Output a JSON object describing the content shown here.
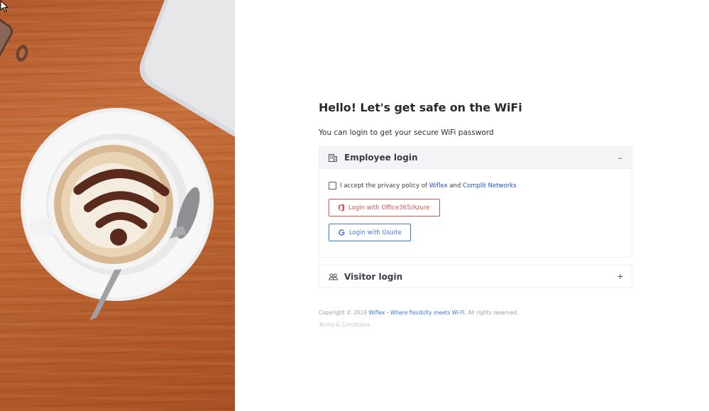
{
  "heading": "Hello! Let's get safe on the WiFi",
  "subheading": "You can login to get your secure WiFi password",
  "employee": {
    "title": "Employee login",
    "toggle": "–",
    "consent": {
      "prefix": "I accept the privacy policy of",
      "link1": "Wiflex",
      "and": "and",
      "link2": "Complit Networks"
    },
    "office_button": "Login with Office365/Azure",
    "gsuite_button": "Login with Gsuite"
  },
  "visitor": {
    "title": "Visitor login",
    "toggle": "+"
  },
  "footer": {
    "copyright": "Copyright © 2019",
    "brand_link": "Wiflex - Where flexibilty meets Wi-Fi.",
    "rights": "All rights reserved.",
    "terms": "Terms & Conditions"
  },
  "colors": {
    "accent_red": "#d9534f",
    "accent_blue": "#3a7bd5",
    "link_blue": "#1f4fc9"
  },
  "icons": {
    "employee": "building-icon",
    "visitor": "users-icon",
    "office": "office-icon",
    "google": "google-icon"
  }
}
